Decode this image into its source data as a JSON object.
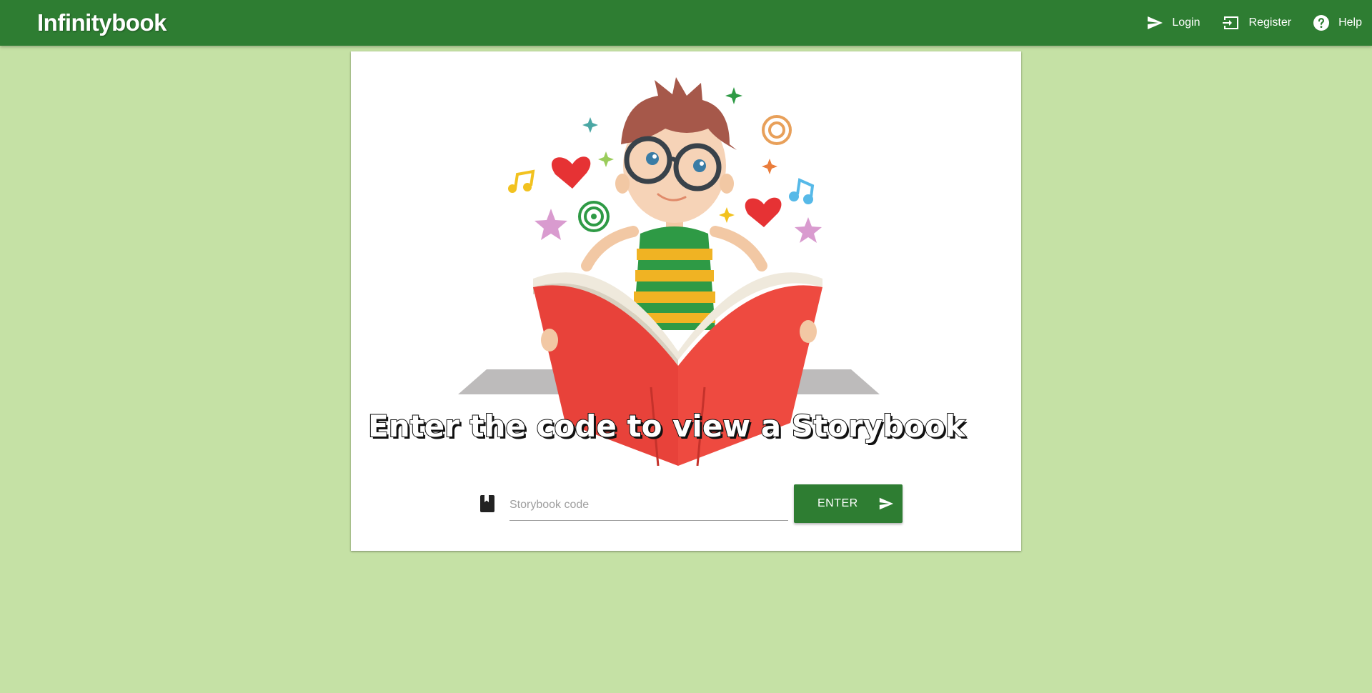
{
  "app": {
    "title": "Infinitybook"
  },
  "nav": {
    "items": [
      {
        "label": "Login",
        "icon": "send-icon"
      },
      {
        "label": "Register",
        "icon": "login-icon"
      },
      {
        "label": "Help",
        "icon": "help-icon"
      }
    ]
  },
  "hero": {
    "headline": "Enter the code to view a Storybook"
  },
  "code_form": {
    "placeholder": "Storybook code",
    "value": "",
    "button_label": "ENTER",
    "field_icon": "book-icon",
    "button_icon": "send-icon"
  },
  "colors": {
    "primary": "#2e7d32",
    "background": "#c5e1a5",
    "card": "#ffffff"
  }
}
